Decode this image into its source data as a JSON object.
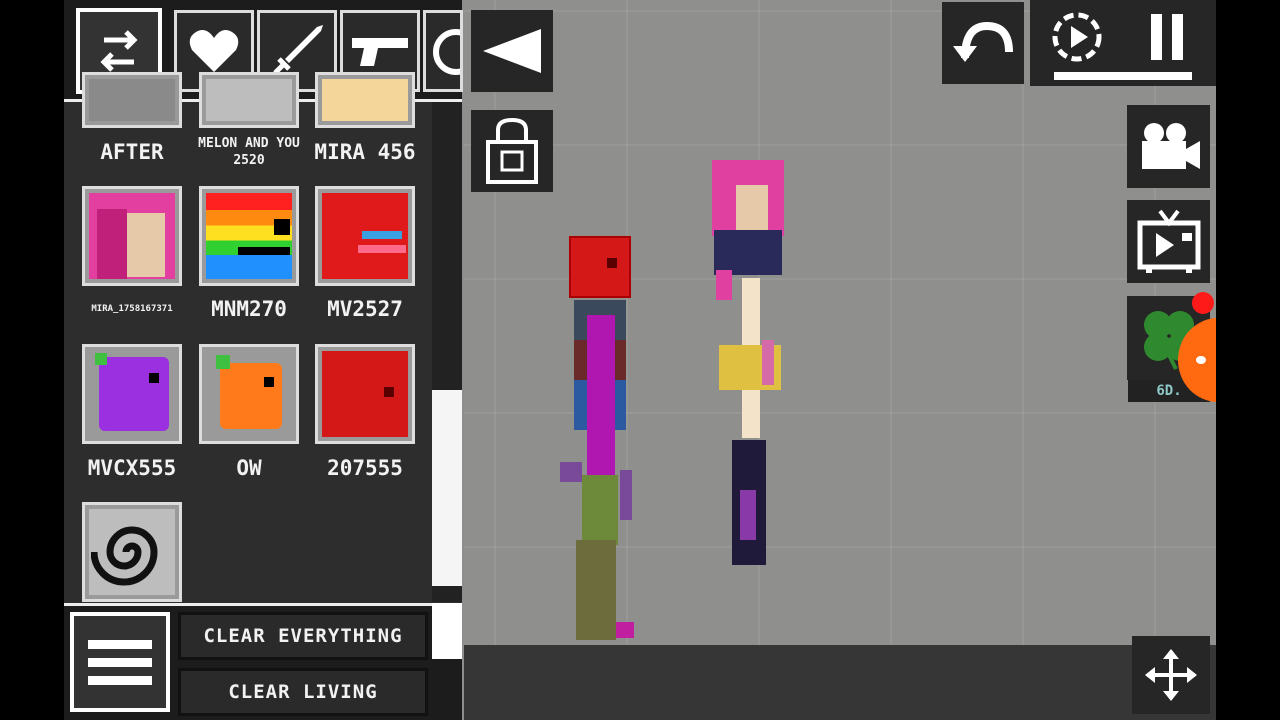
{
  "items": [
    {
      "label": "AFTER",
      "size": "big"
    },
    {
      "label": "MELON AND YOU 2520",
      "size": "small"
    },
    {
      "label": "MIRA 456",
      "size": "big"
    },
    {
      "label": "MIRA_1758167371",
      "size": "tiny"
    },
    {
      "label": "MNM270",
      "size": "big"
    },
    {
      "label": "MV2527",
      "size": "big"
    },
    {
      "label": "MVCX555",
      "size": "big"
    },
    {
      "label": "OW",
      "size": "big"
    },
    {
      "label": "207555",
      "size": "big"
    }
  ],
  "buttons": {
    "clear_everything": "CLEAR EVERYTHING",
    "clear_living": "CLEAR LIVING"
  },
  "world": {
    "clover_timer": "6D."
  },
  "icons": {
    "swap": "swap-arrows-icon",
    "heart": "heart-icon",
    "sword": "sword-icon",
    "gun": "pistol-icon",
    "back": "triangle-left-icon",
    "lock": "lock-icon",
    "undo": "undo-icon",
    "slowmo": "slow-motion-icon",
    "pause": "pause-icon",
    "camera": "video-camera-icon",
    "tv": "tv-icon",
    "clover": "clover-icon",
    "move": "move-arrows-icon"
  },
  "colors": {
    "panel": "#2d2d2d",
    "world": "#8f8f8d",
    "ground": "#363636",
    "accent_orange": "#ff6a10",
    "notify_red": "#ff1a1a"
  }
}
